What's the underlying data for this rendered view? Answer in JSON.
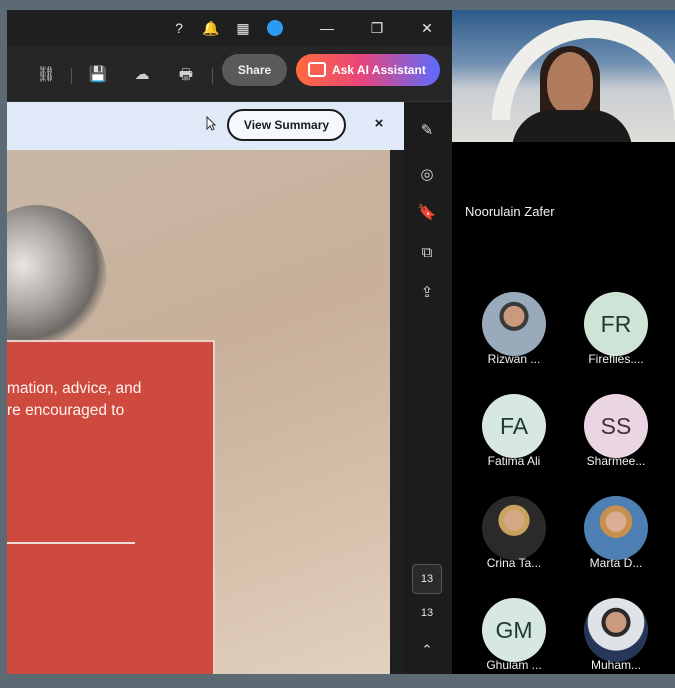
{
  "toolbar": {
    "share_label": "Share",
    "ai_label": "Ask AI Assistant"
  },
  "banner": {
    "view_summary_label": "View Summary",
    "close_label": "×"
  },
  "document": {
    "text_line1": "mation, advice, and",
    "text_line2": "re encouraged to"
  },
  "page_nav": {
    "current_page": "13",
    "total_pages": "13"
  },
  "meeting": {
    "speaker_name": "Noorulain Zafer",
    "participants": [
      {
        "name": "Rizwan ...",
        "initials": "",
        "photo": true
      },
      {
        "name": "Fireflies....",
        "initials": "FR",
        "color": "#cfe3d6"
      },
      {
        "name": "Fatima Ali",
        "initials": "FA",
        "color": "#d6e8df"
      },
      {
        "name": "Sharmee...",
        "initials": "SS",
        "color": "#ead5e3"
      },
      {
        "name": "Crina Ta...",
        "initials": "",
        "photo": true
      },
      {
        "name": "Marta D...",
        "initials": "",
        "photo": true
      },
      {
        "name": "Ghulam ...",
        "initials": "GM",
        "color": "#d6e8df"
      },
      {
        "name": "Muham...",
        "initials": "",
        "photo": true
      }
    ]
  },
  "colors": {
    "accent_red": "#cf4a3e",
    "banner_bg": "#dfe9f8"
  }
}
